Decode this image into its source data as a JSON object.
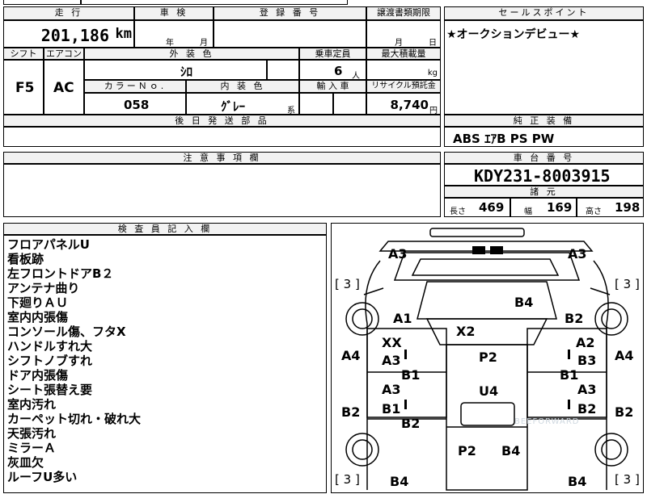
{
  "labels": {
    "mileage": "走 行",
    "inspection": "車 検",
    "reg_no": "登 録 番 号",
    "transfer_deadline": "譲渡書類期限",
    "sales_point": "セールスポイント",
    "shift": "シフト",
    "aircon": "エアコン",
    "ext_color": "外 装 色",
    "capacity": "乗車定員",
    "max_load": "最大積載量",
    "color_no": "カラーＮｏ.",
    "int_color": "内 装 色",
    "import": "輸 入 車",
    "recycle": "リサイクル預託金",
    "later_parts": "後 日 発 送 部 品",
    "genuine_equipment": "純 正 装 備",
    "notes": "注 意 事 項 欄",
    "chassis_no": "車 台 番 号",
    "specs": "諸 元",
    "inspector": "検 査 員 記 入 欄",
    "length": "長さ",
    "width": "幅",
    "height": "高さ",
    "year": "年",
    "month": "月",
    "day": "日",
    "person_unit": "人",
    "kg_unit": "kg",
    "yen_unit": "円",
    "series_suffix": "系"
  },
  "values": {
    "mileage": "201,186",
    "mileage_unit": "km",
    "shift": "F5",
    "aircon": "AC",
    "ext_color": "ｼﾛ",
    "capacity": "6",
    "color_no": "058",
    "int_color": "ｸﾞﾚｰ",
    "recycle": "8,740",
    "sales_point": "★オークションデビュー★",
    "genuine_equipment": "ABS ｴｱB PS PW",
    "chassis_no": "KDY231-8003915",
    "length": "469",
    "width": "169",
    "height": "198"
  },
  "remarks": [
    "フロアパネルU",
    "看板跡",
    "左フロントドアB２",
    "アンテナ曲り",
    "下廻りＡＵ",
    "室内内張傷",
    "コンソール傷、フタX",
    "ハンドルすれ大",
    "シフトノブすれ",
    "ドア内張傷",
    "シート張替え要",
    "室内汚れ",
    "カーペット切れ・破れ大",
    "天張汚れ",
    "ミラーＡ",
    "灰皿欠",
    "ルーフU多い"
  ],
  "diagram": {
    "codes": [
      "A3",
      "A3",
      "B4",
      "A1",
      "B2",
      "X2",
      "XX",
      "A2",
      "A4",
      "A4",
      "A3",
      "P2",
      "B3",
      "B1",
      "B1",
      "A3",
      "U4",
      "A3",
      "B1",
      "B2",
      "B2",
      "B2",
      "B2",
      "P2",
      "B4",
      "B4",
      "B4"
    ],
    "tread": [
      "3",
      "3",
      "3",
      "3"
    ],
    "watermark": "BEEFORWARD"
  }
}
